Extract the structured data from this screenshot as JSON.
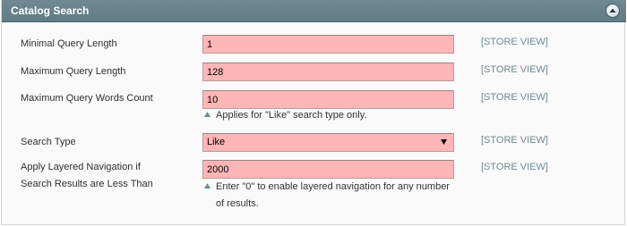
{
  "section": {
    "title": "Catalog Search"
  },
  "fields": {
    "min_query_length": {
      "label": "Minimal Query Length",
      "value": "1",
      "scope": "[STORE VIEW]"
    },
    "max_query_length": {
      "label": "Maximum Query Length",
      "value": "128",
      "scope": "[STORE VIEW]"
    },
    "max_query_words": {
      "label": "Maximum Query Words Count",
      "value": "10",
      "scope": "[STORE VIEW]",
      "note": "Applies for \"Like\" search type only."
    },
    "search_type": {
      "label": "Search Type",
      "value": "Like",
      "scope": "[STORE VIEW]"
    },
    "layered_nav": {
      "label_line1": "Apply Layered Navigation if",
      "label_line2": "Search Results are Less Than",
      "value": "2000",
      "scope": "[STORE VIEW]",
      "note_line1": "Enter \"0\" to enable layered navigation for any number",
      "note_line2": "of results."
    }
  },
  "colors": {
    "header_bg": "#6f8992",
    "field_bg": "#ffb6b6",
    "scope_text": "#6f8992"
  },
  "icons": {
    "collapse": "chevron-up-icon",
    "select_arrow": "triangle-down-icon",
    "note_marker": "triangle-up-icon"
  }
}
